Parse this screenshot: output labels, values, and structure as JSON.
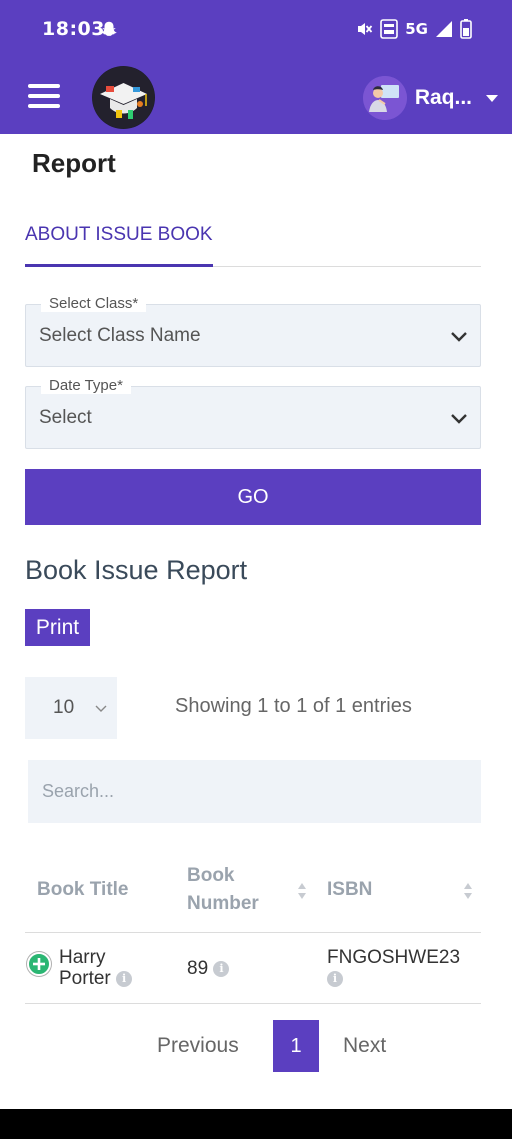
{
  "status_bar": {
    "time": "18:03",
    "network": "5G"
  },
  "app_bar": {
    "user_name": "Raq..."
  },
  "page": {
    "title": "Report"
  },
  "tabs": [
    {
      "label": "ABOUT ISSUE BOOK",
      "active": true
    }
  ],
  "form": {
    "class_field": {
      "label": "Select Class*",
      "value": "Select Class Name"
    },
    "date_type_field": {
      "label": "Date Type*",
      "value": "Select"
    },
    "go_label": "GO"
  },
  "report": {
    "title": "Book Issue Report",
    "print_label": "Print",
    "page_size": "10",
    "entries_info": "Showing 1 to 1 of 1 entries",
    "search_placeholder": "Search...",
    "columns": {
      "book_title": "Book Title",
      "book_number_line1": "Book",
      "book_number_line2": "Number",
      "isbn": "ISBN"
    },
    "rows": [
      {
        "title_line1": "Harry",
        "title_line2": "Porter",
        "book_number": "89",
        "isbn": "FNGOSHWE23"
      }
    ]
  },
  "pagination": {
    "previous": "Previous",
    "current": "1",
    "next": "Next"
  },
  "colors": {
    "primary": "#5b3fc0",
    "accent_text": "#4a35b0",
    "expand_green": "#2bb673"
  },
  "icons": [
    "snapchat-icon",
    "mute-icon",
    "volte-icon",
    "signal-icon",
    "battery-icon",
    "menu-icon",
    "school-logo",
    "user-avatar",
    "chevron-down-icon",
    "sort-icon",
    "info-icon",
    "expand-plus-icon"
  ]
}
